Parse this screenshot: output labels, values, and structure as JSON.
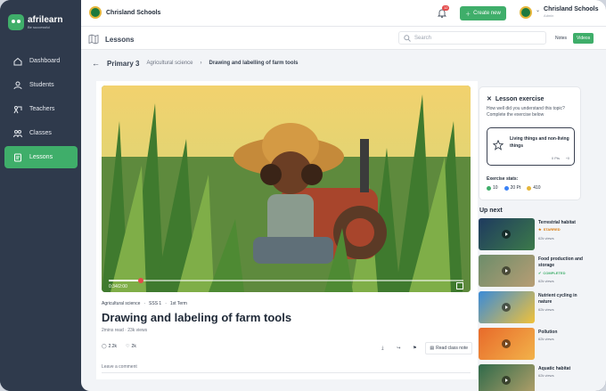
{
  "app": {
    "name": "afrilearn",
    "tagline": "Be successful"
  },
  "colors": {
    "sidebar": "#2f3a4c",
    "accent": "#3fae6a",
    "alert": "#e44b4b"
  },
  "sidebar": {
    "items": [
      {
        "label": "Dashboard",
        "icon": "dashboard-icon"
      },
      {
        "label": "Students",
        "icon": "students-icon"
      },
      {
        "label": "Teachers",
        "icon": "teachers-icon"
      },
      {
        "label": "Classes",
        "icon": "classes-icon"
      },
      {
        "label": "Lessons",
        "icon": "lessons-icon",
        "active": true
      }
    ]
  },
  "topbar": {
    "school_name": "Chrisland Schools",
    "notification_count": "12",
    "create_label": "Create new",
    "user_name": "Chrisland Schools",
    "user_role": "Admin"
  },
  "subbar": {
    "title": "Lessons",
    "search_placeholder": "Search",
    "tab_notes": "Notes",
    "tab_videos": "Videos"
  },
  "breadcrumb": {
    "level": "Primary 3",
    "subject": "Agricultural science",
    "lesson": "Drawing and labelling of farm tools"
  },
  "video": {
    "time": "0:34/2:00",
    "progress": 0.09
  },
  "lesson": {
    "subject": "Agricultural science",
    "class": "SSS 1",
    "term": "1st Term",
    "title": "Drawing and labeling of farm tools",
    "read_time": "2mins read",
    "views": "23k views",
    "comments": "2.2k",
    "likes": "2k",
    "read_note": "Read class note",
    "leave_comment": "Leave a comment"
  },
  "exercise": {
    "title": "Lesson exercise",
    "description": "How well did you understand this topic? Complete the exercise below",
    "card_name": "Living things and non-living things",
    "card_points": "0 Pts",
    "card_count": "0",
    "stats_title": "Exercise stats:",
    "stat_attempts": "10",
    "stat_points": "20 Pt",
    "stat_coins": "410"
  },
  "upnext": {
    "title": "Up next",
    "items": [
      {
        "title": "Terrestrial habitat",
        "tag": "STARRED",
        "tag_color": "#d97706",
        "views": "62k views"
      },
      {
        "title": "Food production and storage",
        "tag": "COMPLETED",
        "tag_color": "#3fae6a",
        "views": "62k views"
      },
      {
        "title": "Nutrient cycling in nature",
        "tag": "",
        "tag_color": "",
        "views": "62k views"
      },
      {
        "title": "Pollution",
        "tag": "",
        "tag_color": "",
        "views": "62k views"
      },
      {
        "title": "Aquatic habitat",
        "tag": "",
        "tag_color": "",
        "views": "62k views"
      }
    ]
  }
}
